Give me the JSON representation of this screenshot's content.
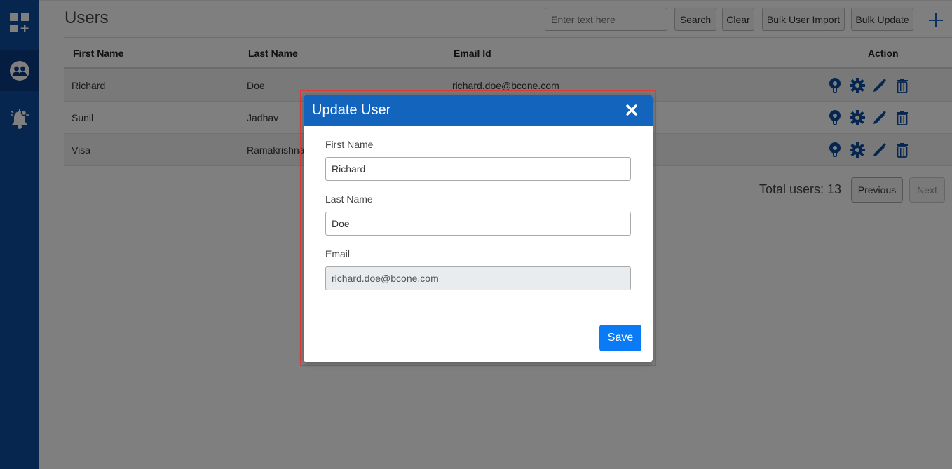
{
  "sidebar": {
    "items": [
      {
        "icon": "dashboard-add-icon"
      },
      {
        "icon": "users-group-icon",
        "active": true
      },
      {
        "icon": "notification-bell-icon"
      }
    ]
  },
  "header": {
    "title": "Users",
    "search_placeholder": "Enter text here",
    "search_label": "Search",
    "clear_label": "Clear",
    "bulk_import_label": "Bulk User Import",
    "bulk_update_label": "Bulk Update",
    "add_icon": "plus-icon"
  },
  "table": {
    "columns": [
      "First Name",
      "Last Name",
      "Email Id",
      "Action"
    ],
    "rows": [
      {
        "first_name": "Richard",
        "last_name": "Doe",
        "email": "richard.doe@bcone.com"
      },
      {
        "first_name": "Sunil",
        "last_name": "Jadhav",
        "email": ""
      },
      {
        "first_name": "Visa",
        "last_name": "Ramakrishnan",
        "email": ""
      }
    ],
    "action_icons": [
      "user-key-icon",
      "gear-icon",
      "pencil-icon",
      "trash-icon"
    ]
  },
  "pagination": {
    "total_label": "Total users: 13",
    "previous_label": "Previous",
    "next_label": "Next"
  },
  "modal": {
    "title": "Update User",
    "close_icon": "close-icon",
    "fields": [
      {
        "label": "First Name",
        "value": "Richard"
      },
      {
        "label": "Last Name",
        "value": "Doe"
      },
      {
        "label": "Email",
        "value": "richard.doe@bcone.com"
      }
    ],
    "save_label": "Save"
  },
  "colors": {
    "sidebar": "#0d4a9e",
    "modal_header": "#1264bc",
    "icon_blue": "#0d4a9e",
    "save_button": "#0a7bf5",
    "highlight_border": "#e03a3a"
  }
}
